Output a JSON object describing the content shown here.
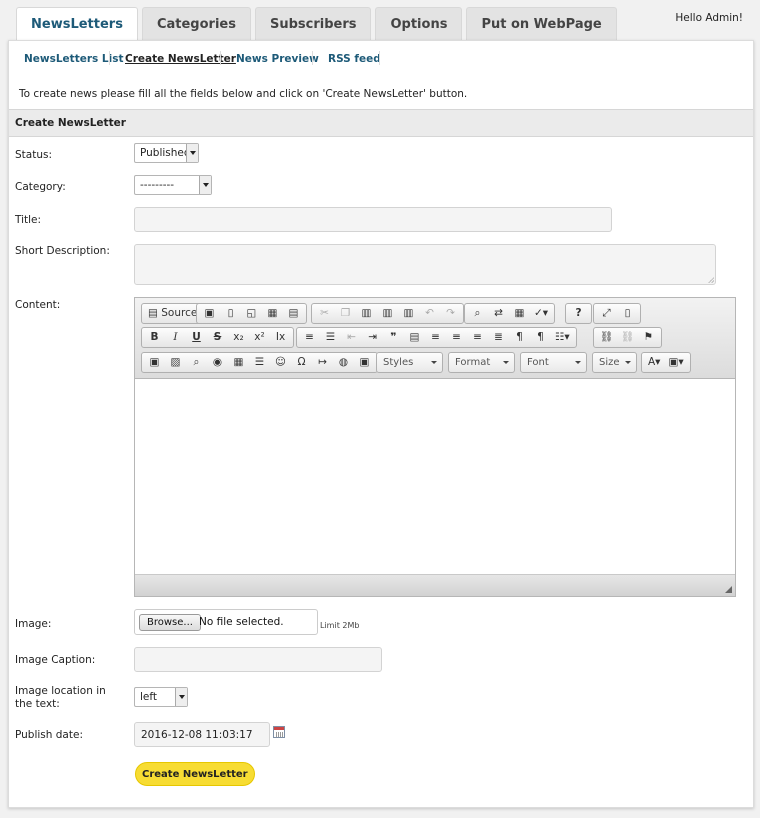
{
  "tabs": [
    "NewsLetters",
    "Categories",
    "Subscribers",
    "Options",
    "Put on WebPage"
  ],
  "greeting": "Hello Admin!",
  "subnav": [
    "NewsLetters List",
    "Create NewsLetter",
    "News Preview",
    "RSS feed"
  ],
  "intro": "To create news please fill all the fields below and click on 'Create NewsLetter' button.",
  "form": {
    "heading": "Create NewsLetter",
    "status_label": "Status:",
    "status_value": "Published",
    "category_label": "Category:",
    "category_value": "---------",
    "title_label": "Title:",
    "short_desc_label": "Short Description:",
    "content_label": "Content:",
    "image_label": "Image:",
    "browse_label": "Browse...",
    "no_file": "No file selected.",
    "limit": "Limit 2Mb",
    "caption_label": "Image Caption:",
    "location_label": "Image location in the text:",
    "location_value": "left",
    "publish_label": "Publish date:",
    "publish_value": "2016-12-08 11:03:17",
    "submit_label": "Create NewsLetter"
  },
  "editor": {
    "source_label": "Source",
    "combos": [
      "Styles",
      "Format",
      "Font",
      "Size"
    ],
    "bold": "B",
    "italic": "I",
    "underline": "U",
    "strike": "S",
    "help": "?"
  }
}
